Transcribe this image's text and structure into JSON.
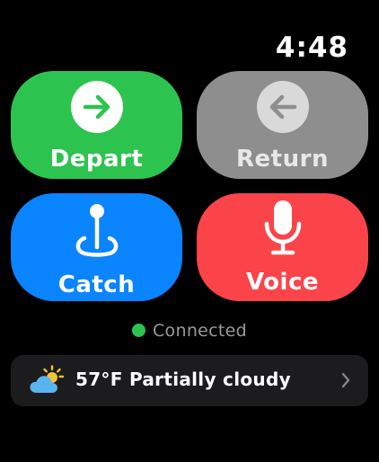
{
  "status_bar": {
    "time": "4:48"
  },
  "tiles": [
    {
      "label": "Depart",
      "icon": "arrow-right-icon",
      "color": "#2dc34f"
    },
    {
      "label": "Return",
      "icon": "arrow-left-icon",
      "color": "#8e8e8e"
    },
    {
      "label": "Catch",
      "icon": "location-pin-icon",
      "color": "#0a84ff"
    },
    {
      "label": "Voice",
      "icon": "microphone-icon",
      "color": "#fb444a"
    }
  ],
  "connection": {
    "label": "Connected",
    "dot_color": "#2dc34f"
  },
  "weather": {
    "summary": "57°F Partially cloudy",
    "icon": "partly-cloudy-icon",
    "chevron": "chevron-right-icon"
  }
}
